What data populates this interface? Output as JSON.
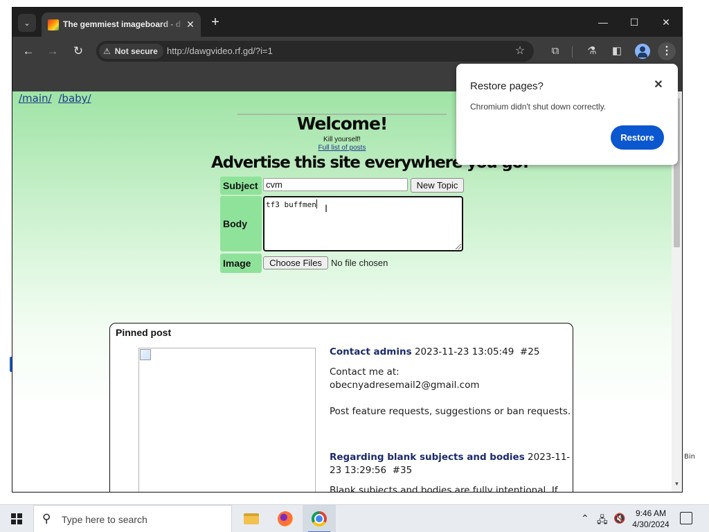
{
  "browser": {
    "tab_title": "The gemmiest imageboard - d",
    "security_label": "Not secure",
    "url": "http://dawgvideo.rf.gd/?i=1"
  },
  "page": {
    "board_links": [
      "/main/",
      "/baby/"
    ],
    "heading": "Welcome!",
    "tagline": "Kill yourself!",
    "full_list_link": "Full list of posts",
    "advertise": "Advertise this site everywhere you go!"
  },
  "form": {
    "subject_label": "Subject",
    "subject_value": "cvm",
    "new_topic_button": "New Topic",
    "body_label": "Body",
    "body_value": "tf3 buffmen",
    "image_label": "Image",
    "choose_files_button": "Choose Files",
    "no_file_text": "No file chosen"
  },
  "pinned": {
    "title": "Pinned post",
    "posts": [
      {
        "subject": "Contact admins",
        "date": "2023-11-23 13:05:49",
        "number": "#25",
        "body_lines": [
          "Contact me at:",
          "obecnyadresemail2@gmail.com",
          "",
          "Post feature requests, suggestions or ban requests."
        ]
      },
      {
        "subject": "Regarding blank subjects and bodies",
        "date": "2023-11-23 13:29:56",
        "number": "#35",
        "body_lines": [
          "Blank subjects and bodies are fully intentional. If"
        ]
      }
    ]
  },
  "restore_bubble": {
    "title": "Restore pages?",
    "message": "Chromium didn't shut down correctly.",
    "button": "Restore"
  },
  "taskbar": {
    "search_placeholder": "Type here to search",
    "time": "9:46 AM",
    "date": "4/30/2024"
  },
  "desktop_fragments": [
    "Bin"
  ],
  "icons": {
    "tab_search": "chevron-down-icon",
    "tab_close": "close-icon",
    "new_tab": "plus-icon",
    "back": "arrow-left-icon",
    "forward": "arrow-right-icon",
    "reload": "reload-icon",
    "warning": "warning-triangle-icon",
    "bookmark": "star-icon",
    "extensions": "puzzle-icon",
    "labs": "flask-icon",
    "side_panel": "side-panel-icon",
    "profile": "profile-icon",
    "menu": "kebab-menu-icon"
  },
  "colors": {
    "page_gradient_top": "#9fe3a5",
    "form_label_bg": "#8fe29a",
    "link": "#1a3a8a",
    "restore_button": "#0b57d0"
  }
}
